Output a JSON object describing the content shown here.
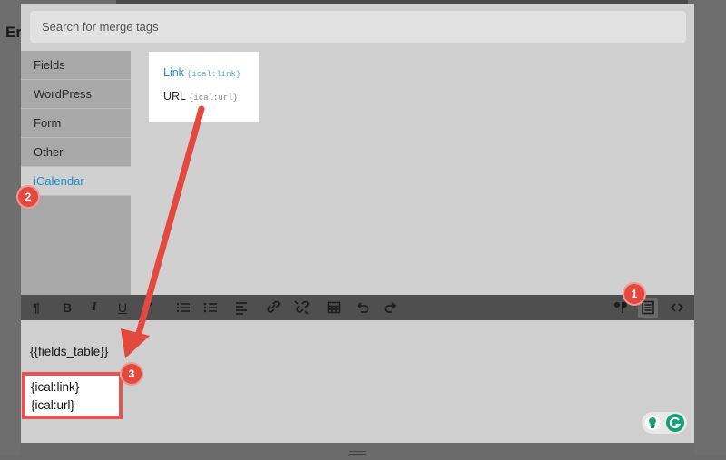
{
  "page": {
    "bg_title": "Er"
  },
  "search": {
    "placeholder": "Search for merge tags"
  },
  "categories": [
    {
      "label": "Fields"
    },
    {
      "label": "WordPress"
    },
    {
      "label": "Form"
    },
    {
      "label": "Other"
    },
    {
      "label": "iCalendar",
      "active": true
    }
  ],
  "tags": [
    {
      "label": "Link",
      "code": "{ical:link}"
    },
    {
      "label": "URL",
      "code": "{ical:url}"
    }
  ],
  "toolbar": {
    "paragraph": "¶",
    "bold": "B",
    "italic": "I",
    "underline": "U",
    "icons": [
      "pilcrow-icon",
      "bold-icon",
      "italic-icon",
      "underline-icon",
      "strikethrough-icon",
      "ordered-list-icon",
      "bullet-list-icon",
      "align-left-icon",
      "link-icon",
      "unlink-icon",
      "table-icon",
      "undo-icon",
      "redo-icon",
      "merge-tags-icon",
      "list-box-icon",
      "code-view-icon"
    ]
  },
  "editor": {
    "line1": "{{fields_table}}",
    "line2": "{ical:link}",
    "line3": "{ical:url}"
  },
  "annotations": {
    "badge1": "1",
    "badge2": "2",
    "badge3": "3",
    "accent": "#e3493f"
  },
  "colors": {
    "active_link": "#1d8fc7",
    "highlight_border": "#e25555"
  }
}
